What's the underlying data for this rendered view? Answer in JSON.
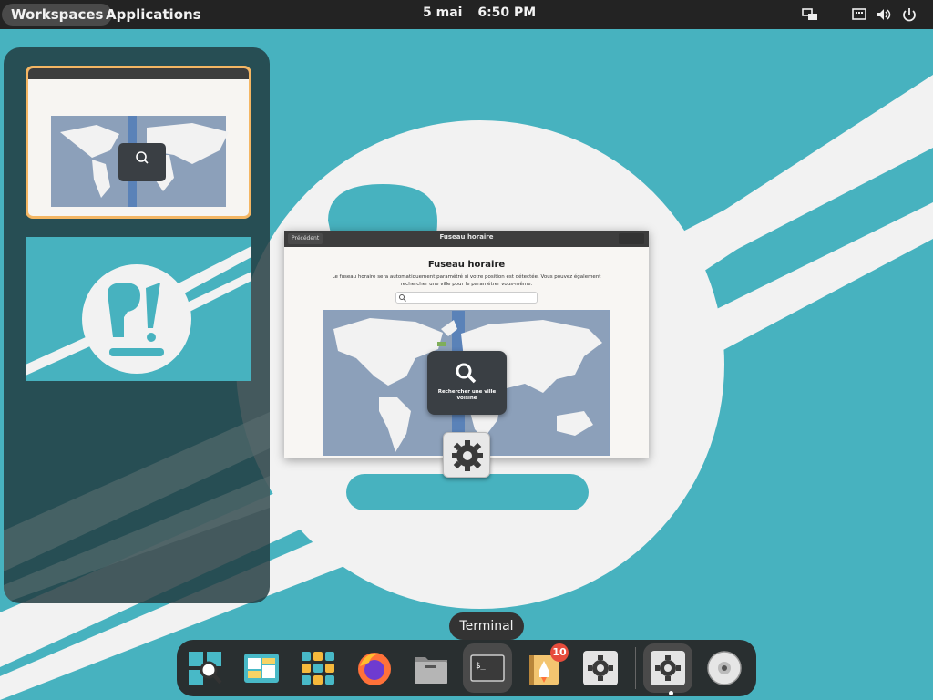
{
  "top_panel": {
    "workspaces_label": "Workspaces",
    "applications_label": "Applications",
    "clock_date": "5 mai",
    "clock_time": "6:50 PM",
    "tray_icons": [
      "network-icon",
      "keyboard-icon",
      "volume-icon",
      "power-icon"
    ]
  },
  "installer_window": {
    "title": "Fuseau horaire",
    "prev_button_label": "Précédent",
    "heading": "Fuseau horaire",
    "description": "Le fuseau horaire sera automatiquement paramétré si votre position est détectée. Vous pouvez également rechercher une ville pour le paramétrer vous-même.",
    "popover_label": "Rechercher une ville voisine"
  },
  "dock": {
    "tooltip": "Terminal",
    "items": [
      {
        "name": "installer-app",
        "icon": "installer-icon"
      },
      {
        "name": "multitasking-view",
        "icon": "multitasking-icon"
      },
      {
        "name": "applications-grid",
        "icon": "app-grid-icon"
      },
      {
        "name": "firefox",
        "icon": "firefox-icon"
      },
      {
        "name": "files",
        "icon": "files-icon"
      },
      {
        "name": "terminal",
        "icon": "terminal-icon"
      },
      {
        "name": "pop-shop",
        "icon": "shop-icon",
        "badge": "10"
      },
      {
        "name": "settings",
        "icon": "settings-icon"
      },
      {
        "name": "settings-running",
        "icon": "settings-icon"
      },
      {
        "name": "disks",
        "icon": "disk-icon"
      }
    ]
  },
  "colors": {
    "panel_bg": "#232323",
    "wallpaper_teal": "#47b2bf",
    "wallpaper_white": "#f2f2f2",
    "workspace_highlight": "#f4b663",
    "badge_red": "#e74c3c"
  }
}
